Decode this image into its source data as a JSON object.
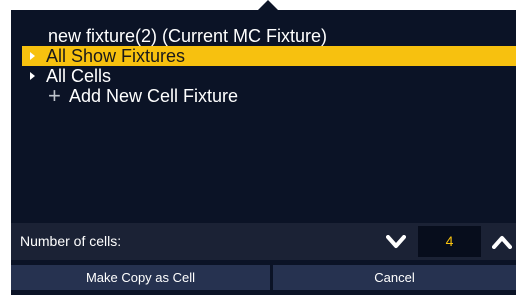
{
  "tree": {
    "current_fixture": "new fixture(2) (Current MC Fixture)",
    "items": [
      {
        "label": "All Show Fixtures"
      },
      {
        "label": "All Cells"
      }
    ],
    "add_label": "Add New Cell Fixture"
  },
  "cells": {
    "label": "Number of cells:",
    "value": "4"
  },
  "buttons": {
    "make_copy": "Make Copy as Cell",
    "cancel": "Cancel"
  },
  "colors": {
    "background": "#0b1326",
    "selected": "#f7c10f",
    "button": "#263250"
  }
}
